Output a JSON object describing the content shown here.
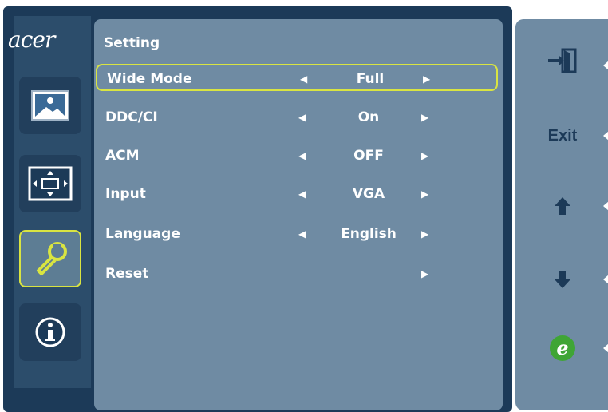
{
  "brand": {
    "logo_text": "acer"
  },
  "nav": [
    {
      "name": "picture",
      "icon": "picture-icon"
    },
    {
      "name": "display",
      "icon": "display-position-icon"
    },
    {
      "name": "setting",
      "icon": "wrench-icon",
      "active": true
    },
    {
      "name": "information",
      "icon": "info-icon"
    }
  ],
  "panel": {
    "title": "Setting",
    "rows": [
      {
        "label": "Wide Mode",
        "value": "Full",
        "left_arrow": "◀",
        "right_arrow": "▶"
      },
      {
        "label": "DDC/CI",
        "value": "On",
        "left_arrow": "◀",
        "right_arrow": "▶"
      },
      {
        "label": "ACM",
        "value": "OFF",
        "left_arrow": "◀",
        "right_arrow": "▶"
      },
      {
        "label": "Input",
        "value": "VGA",
        "left_arrow": "◀",
        "right_arrow": "▶"
      },
      {
        "label": "Language",
        "value": "English",
        "left_arrow": "◀",
        "right_arrow": "▶"
      },
      {
        "label": "Reset",
        "value": "",
        "left_arrow": "",
        "right_arrow": "▶"
      }
    ],
    "selected_row": "Wide Mode"
  },
  "side_buttons": {
    "exit_icon": "exit-door-icon",
    "exit_label": "Exit",
    "up_icon": "arrow-up-icon",
    "down_icon": "arrow-down-icon",
    "empowering_icon": "empowering-e-icon"
  },
  "colors": {
    "osd_background": "#1c3a58",
    "panel_background": "#6f8ba3",
    "highlight": "#d9e441",
    "text": "#ffffff",
    "empowering_green": "#3fa535"
  }
}
